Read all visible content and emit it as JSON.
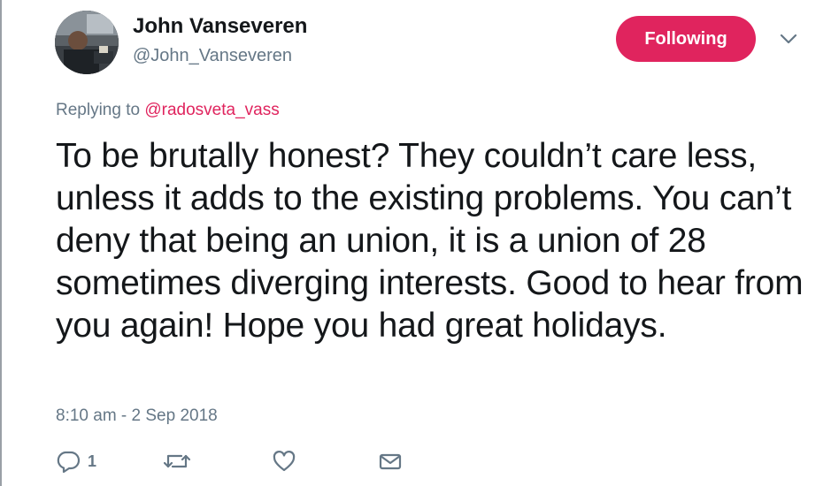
{
  "user": {
    "name": "John Vanseveren",
    "handle": "@John_Vanseveren"
  },
  "follow_button": {
    "label": "Following",
    "color": "#e0245e"
  },
  "reply": {
    "prefix": "Replying to",
    "mention": "@radosveta_vass"
  },
  "tweet": {
    "text": "To be brutally honest? They couldn’t care less, unless it adds to the existing problems. You can’t deny that being an union, it is a union of 28 sometimes diverging interests. Good to hear from you again! Hope you had great holidays.",
    "timestamp": "8:10 am - 2 Sep 2018"
  },
  "actions": {
    "reply_count": "1",
    "icons": [
      "reply-icon",
      "retweet-icon",
      "like-icon",
      "direct-message-icon"
    ]
  },
  "colors": {
    "accent": "#e0245e",
    "secondary_text": "#657786",
    "primary_text": "#14171a"
  }
}
